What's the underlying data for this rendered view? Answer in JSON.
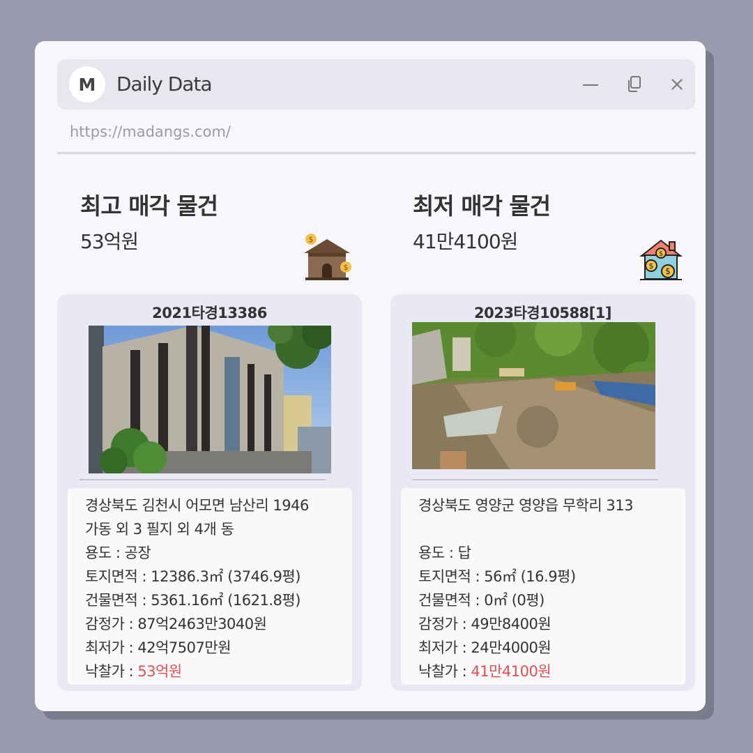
{
  "app": {
    "logo_letter": "M",
    "title": "Daily Data",
    "url": "https://madangs.com/"
  },
  "highest": {
    "heading": "최고 매각 물건",
    "value": "53억원",
    "card": {
      "case_number": "2021타경13386",
      "address_line1": "경상북도 김천시 어모면 남산리 1946",
      "address_line2": "가동 외 3 필지 외 4개 동",
      "usage": "용도 : 공장",
      "land_area": "토지면적 : 12386.3㎡ (3746.9평)",
      "building_area": "건물면적 : 5361.16㎡ (1621.8평)",
      "appraisal": "감정가 : 87억2463만3040원",
      "minimum": "최저가 : 42억7507만원",
      "winning_label": "낙찰가 : ",
      "winning_value": "53억원"
    }
  },
  "lowest": {
    "heading": "최저 매각 물건",
    "value": "41만4100원",
    "card": {
      "case_number": "2023타경10588[1]",
      "address_line1": "경상북도 영양군 영양읍 무학리 313",
      "address_line2": "",
      "usage": "용도 : 답",
      "land_area": "토지면적 : 56㎡ (16.9평)",
      "building_area": "건물면적 : 0㎡ (0평)",
      "appraisal": "감정가 : 49만8400원",
      "minimum": "최저가 : 24만4000원",
      "winning_label": "낙찰가 : ",
      "winning_value": "41만4100원"
    }
  },
  "colors": {
    "accent_price": "#e05050",
    "background": "#999aad",
    "window": "#f6f6fb",
    "card": "#e8e9f4"
  },
  "icons": [
    "minimize-icon",
    "copy-icon",
    "close-icon",
    "house-coin-icon",
    "house-money-icon"
  ]
}
